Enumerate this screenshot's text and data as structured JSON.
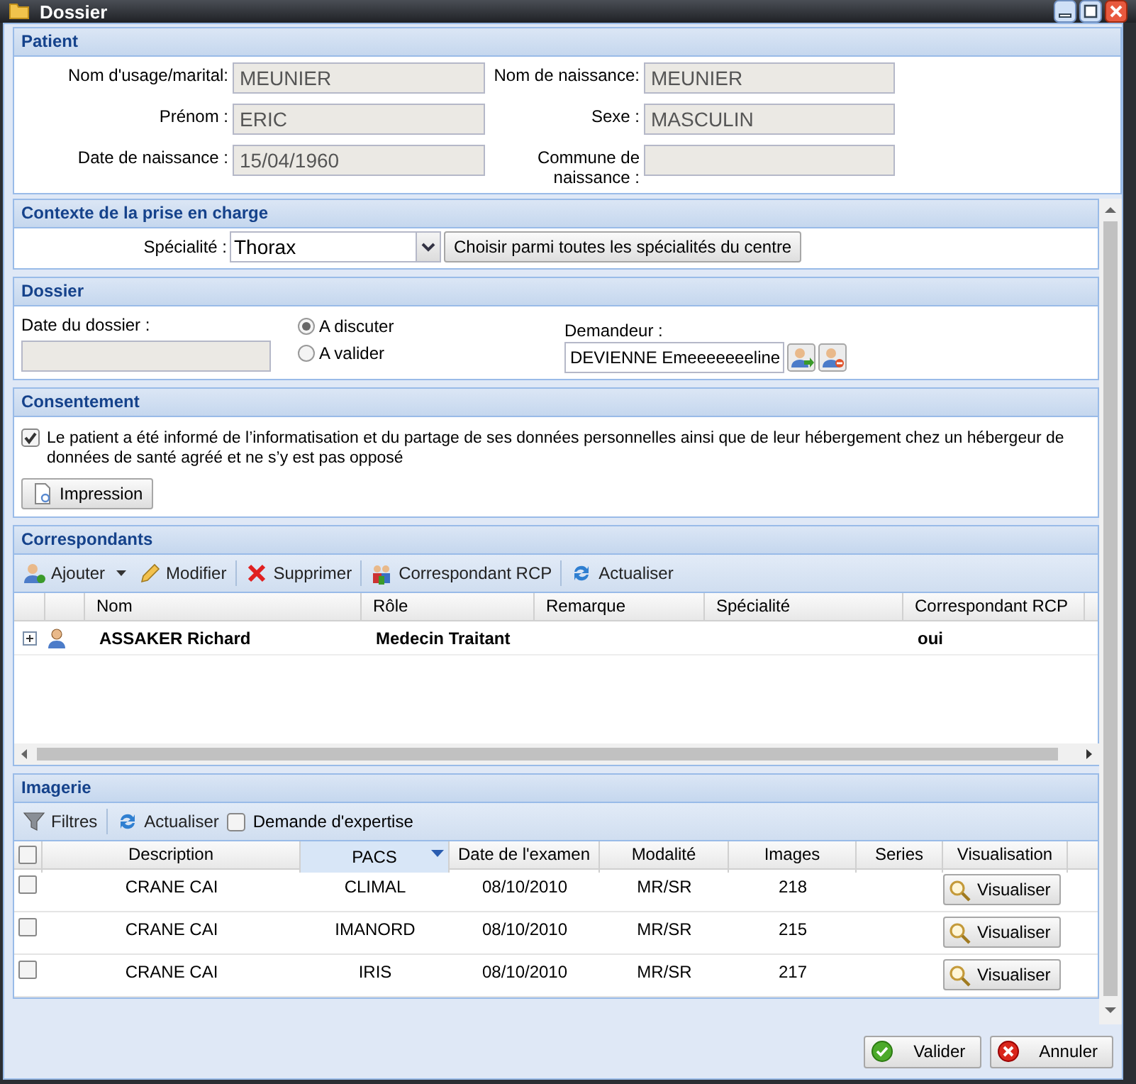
{
  "window": {
    "title": "Dossier"
  },
  "patient": {
    "title": "Patient",
    "fields": [
      {
        "label": "Nom d'usage/marital:",
        "value": "MEUNIER"
      },
      {
        "label": "Nom de naissance:",
        "value": "MEUNIER"
      },
      {
        "label": "Prénom :",
        "value": "ERIC"
      },
      {
        "label": "Sexe :",
        "value": "MASCULIN"
      },
      {
        "label": "Date de naissance :",
        "value": "15/04/1960"
      },
      {
        "label": "Commune de naissance :"
      }
    ]
  },
  "contexte": {
    "title": "Contexte de la prise en charge",
    "label": "Spécialité :",
    "value": "Thorax",
    "button": "Choisir parmi toutes les spécialités du centre"
  },
  "dossier": {
    "title": "Dossier",
    "date_label": "Date du dossier :",
    "status": [
      {
        "label": "A discuter",
        "selected": true
      },
      {
        "label": "A valider",
        "selected": false
      }
    ],
    "demandeur_label": "Demandeur :",
    "demandeur": "DEVIENNE Emeeeeeeeline"
  },
  "consentement": {
    "title": "Consentement",
    "checked": true,
    "text": "Le patient a été informé de l’informatisation et du partage de ses données personnelles ainsi que de leur hébergement chez un hébergeur de données de santé agréé et ne s’y est pas opposé",
    "button": "Impression"
  },
  "correspondants": {
    "title": "Correspondants",
    "toolbar": [
      {
        "kind": "menu",
        "label": "Ajouter"
      },
      {
        "kind": "button",
        "label": "Modifier"
      },
      {
        "kind": "separator"
      },
      {
        "kind": "button",
        "label": "Supprimer"
      },
      {
        "kind": "separator"
      },
      {
        "kind": "button",
        "label": "Correspondant RCP"
      },
      {
        "kind": "separator"
      },
      {
        "kind": "button",
        "label": "Actualiser"
      }
    ],
    "columns": [
      "Nom",
      "Rôle",
      "Remarque",
      "Spécialité",
      "Correspondant RCP"
    ],
    "rows": [
      {
        "expanded": false,
        "cells": [
          "ASSAKER Richard",
          "Medecin Traitant",
          "",
          "",
          "oui"
        ]
      }
    ]
  },
  "imagerie": {
    "title": "Imagerie",
    "toolbar": [
      {
        "kind": "button",
        "label": "Filtres"
      },
      {
        "kind": "separator"
      },
      {
        "kind": "button",
        "label": "Actualiser"
      },
      {
        "kind": "checkbox",
        "label": "Demande d'expertise",
        "checked": false
      }
    ],
    "all_checked": false,
    "columns": [
      {
        "label": "Description",
        "sorted": false
      },
      {
        "label": "PACS",
        "sorted": true
      },
      {
        "label": "Date de l'examen",
        "sorted": false
      },
      {
        "label": "Modalité",
        "sorted": false
      },
      {
        "label": "Images",
        "sorted": false
      },
      {
        "label": "Series",
        "sorted": false
      },
      {
        "label": "Visualisation",
        "sorted": false
      }
    ],
    "rows": [
      {
        "checked": false,
        "cells": [
          "CRANE CAI",
          "CLIMAL",
          "08/10/2010",
          "MR/SR",
          "218",
          ""
        ],
        "action": "Visualiser"
      },
      {
        "checked": false,
        "cells": [
          "CRANE CAI",
          "IMANORD",
          "08/10/2010",
          "MR/SR",
          "215",
          ""
        ],
        "action": "Visualiser"
      },
      {
        "checked": false,
        "cells": [
          "CRANE CAI",
          "IRIS",
          "08/10/2010",
          "MR/SR",
          "217",
          ""
        ],
        "action": "Visualiser"
      }
    ]
  },
  "footer": {
    "buttons": [
      {
        "kind": "ok",
        "label": "Valider"
      },
      {
        "kind": "cancel",
        "label": "Annuler"
      }
    ]
  }
}
